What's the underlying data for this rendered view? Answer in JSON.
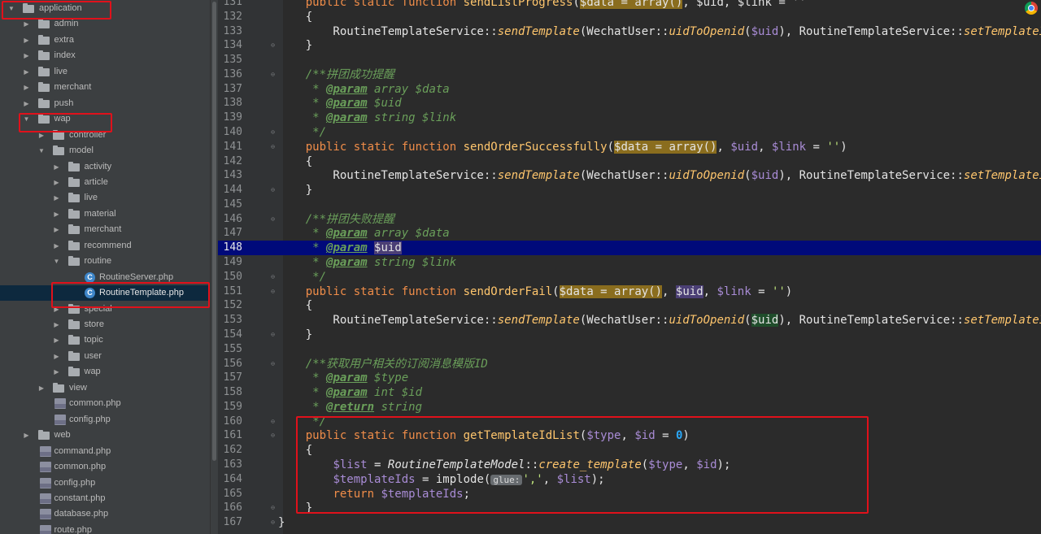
{
  "tree": [
    {
      "label": "application",
      "kind": "folder",
      "depth": 0,
      "open": true
    },
    {
      "label": "admin",
      "kind": "folder",
      "depth": 1,
      "open": false
    },
    {
      "label": "extra",
      "kind": "folder",
      "depth": 1,
      "open": false
    },
    {
      "label": "index",
      "kind": "folder",
      "depth": 1,
      "open": false
    },
    {
      "label": "live",
      "kind": "folder",
      "depth": 1,
      "open": false
    },
    {
      "label": "merchant",
      "kind": "folder",
      "depth": 1,
      "open": false
    },
    {
      "label": "push",
      "kind": "folder",
      "depth": 1,
      "open": false
    },
    {
      "label": "wap",
      "kind": "folder",
      "depth": 1,
      "open": true
    },
    {
      "label": "controller",
      "kind": "folder",
      "depth": 2,
      "open": false
    },
    {
      "label": "model",
      "kind": "folder",
      "depth": 2,
      "open": true
    },
    {
      "label": "activity",
      "kind": "folder",
      "depth": 3,
      "open": false
    },
    {
      "label": "article",
      "kind": "folder",
      "depth": 3,
      "open": false
    },
    {
      "label": "live",
      "kind": "folder",
      "depth": 3,
      "open": false
    },
    {
      "label": "material",
      "kind": "folder",
      "depth": 3,
      "open": false
    },
    {
      "label": "merchant",
      "kind": "folder",
      "depth": 3,
      "open": false
    },
    {
      "label": "recommend",
      "kind": "folder",
      "depth": 3,
      "open": false
    },
    {
      "label": "routine",
      "kind": "folder",
      "depth": 3,
      "open": true
    },
    {
      "label": "RoutineServer.php",
      "kind": "class",
      "depth": 4
    },
    {
      "label": "RoutineTemplate.php",
      "kind": "class",
      "depth": 4,
      "selected": true
    },
    {
      "label": "special",
      "kind": "folder",
      "depth": 3,
      "open": false
    },
    {
      "label": "store",
      "kind": "folder",
      "depth": 3,
      "open": false
    },
    {
      "label": "topic",
      "kind": "folder",
      "depth": 3,
      "open": false
    },
    {
      "label": "user",
      "kind": "folder",
      "depth": 3,
      "open": false
    },
    {
      "label": "wap",
      "kind": "folder",
      "depth": 3,
      "open": false
    },
    {
      "label": "view",
      "kind": "folder",
      "depth": 2,
      "open": false
    },
    {
      "label": "common.php",
      "kind": "php",
      "depth": 2
    },
    {
      "label": "config.php",
      "kind": "php",
      "depth": 2
    },
    {
      "label": "web",
      "kind": "folder",
      "depth": 1,
      "open": false
    },
    {
      "label": "command.php",
      "kind": "php",
      "depth": 1
    },
    {
      "label": "common.php",
      "kind": "php",
      "depth": 1
    },
    {
      "label": "config.php",
      "kind": "php",
      "depth": 1
    },
    {
      "label": "constant.php",
      "kind": "php",
      "depth": 1
    },
    {
      "label": "database.php",
      "kind": "php",
      "depth": 1
    },
    {
      "label": "route.php",
      "kind": "php",
      "depth": 1
    }
  ],
  "code": [
    {
      "n": "131",
      "fold": "",
      "t": [
        [
          "    ",
          ""
        ],
        [
          "public static function ",
          "t-kw"
        ],
        [
          "sendListProgress",
          "t-fn"
        ],
        [
          "(",
          ""
        ],
        [
          "$data = array()",
          "t-hl-o"
        ],
        [
          ", $uid, $link = ''",
          ""
        ]
      ]
    },
    {
      "n": "132",
      "fold": "",
      "t": [
        [
          "    {",
          ""
        ]
      ]
    },
    {
      "n": "133",
      "fold": "",
      "t": [
        [
          "        RoutineTemplateService::",
          ""
        ],
        [
          "sendTemplate",
          "t-st"
        ],
        [
          "(WechatUser::",
          ""
        ],
        [
          "uidToOpenid",
          "t-st"
        ],
        [
          "(",
          ""
        ],
        [
          "$uid",
          "t-var"
        ],
        [
          "), RoutineTemplateService::",
          ""
        ],
        [
          "setTemplateId",
          "t-st"
        ]
      ]
    },
    {
      "n": "134",
      "fold": "⊖",
      "t": [
        [
          "    }",
          ""
        ]
      ]
    },
    {
      "n": "135",
      "fold": "",
      "t": []
    },
    {
      "n": "136",
      "fold": "⊖",
      "t": [
        [
          "    /**拼团成功提醒",
          "t-cm"
        ]
      ]
    },
    {
      "n": "137",
      "fold": "",
      "t": [
        [
          "     * ",
          "t-cm"
        ],
        [
          "@param",
          "t-tag"
        ],
        [
          " array $data",
          "t-cm"
        ]
      ]
    },
    {
      "n": "138",
      "fold": "",
      "t": [
        [
          "     * ",
          "t-cm"
        ],
        [
          "@param",
          "t-tag"
        ],
        [
          " $uid",
          "t-cm"
        ]
      ]
    },
    {
      "n": "139",
      "fold": "",
      "t": [
        [
          "     * ",
          "t-cm"
        ],
        [
          "@param",
          "t-tag"
        ],
        [
          " string $link",
          "t-cm"
        ]
      ]
    },
    {
      "n": "140",
      "fold": "⊖",
      "t": [
        [
          "     */",
          "t-cm"
        ]
      ]
    },
    {
      "n": "141",
      "fold": "⊖",
      "t": [
        [
          "    ",
          ""
        ],
        [
          "public static function ",
          "t-kw"
        ],
        [
          "sendOrderSuccessfully",
          "t-fn"
        ],
        [
          "(",
          ""
        ],
        [
          "$data = array()",
          "t-hl-o"
        ],
        [
          ", ",
          ""
        ],
        [
          "$uid",
          "t-var"
        ],
        [
          ", ",
          ""
        ],
        [
          "$link",
          "t-var"
        ],
        [
          " = ",
          ""
        ],
        [
          "''",
          "t-str"
        ],
        [
          ")",
          ""
        ]
      ]
    },
    {
      "n": "142",
      "fold": "",
      "t": [
        [
          "    {",
          ""
        ]
      ]
    },
    {
      "n": "143",
      "fold": "",
      "t": [
        [
          "        RoutineTemplateService::",
          ""
        ],
        [
          "sendTemplate",
          "t-st"
        ],
        [
          "(WechatUser::",
          ""
        ],
        [
          "uidToOpenid",
          "t-st"
        ],
        [
          "(",
          ""
        ],
        [
          "$uid",
          "t-var"
        ],
        [
          "), RoutineTemplateService::",
          ""
        ],
        [
          "setTemplateId",
          "t-st"
        ]
      ]
    },
    {
      "n": "144",
      "fold": "⊖",
      "t": [
        [
          "    }",
          ""
        ]
      ]
    },
    {
      "n": "145",
      "fold": "",
      "t": []
    },
    {
      "n": "146",
      "fold": "⊖",
      "t": [
        [
          "    /**拼团失败提醒",
          "t-cm"
        ]
      ]
    },
    {
      "n": "147",
      "fold": "",
      "t": [
        [
          "     * ",
          "t-cm"
        ],
        [
          "@param",
          "t-tag"
        ],
        [
          " array $data",
          "t-cm"
        ]
      ]
    },
    {
      "n": "148",
      "fold": "",
      "cur": true,
      "t": [
        [
          "     * ",
          "t-cm"
        ],
        [
          "@param",
          "t-tag"
        ],
        [
          " ",
          "t-cm"
        ],
        [
          "$uid",
          "t-hl-p"
        ]
      ]
    },
    {
      "n": "149",
      "fold": "",
      "t": [
        [
          "     * ",
          "t-cm"
        ],
        [
          "@param",
          "t-tag"
        ],
        [
          " string $link",
          "t-cm"
        ]
      ]
    },
    {
      "n": "150",
      "fold": "⊖",
      "t": [
        [
          "     */",
          "t-cm"
        ]
      ]
    },
    {
      "n": "151",
      "fold": "⊖",
      "t": [
        [
          "    ",
          ""
        ],
        [
          "public static function ",
          "t-kw"
        ],
        [
          "sendOrderFail",
          "t-fn"
        ],
        [
          "(",
          ""
        ],
        [
          "$data = array()",
          "t-hl-o"
        ],
        [
          ", ",
          ""
        ],
        [
          "$uid",
          "t-hl-p"
        ],
        [
          ", ",
          ""
        ],
        [
          "$link",
          "t-var"
        ],
        [
          " = ",
          ""
        ],
        [
          "''",
          "t-str"
        ],
        [
          ")",
          ""
        ]
      ]
    },
    {
      "n": "152",
      "fold": "",
      "t": [
        [
          "    {",
          ""
        ]
      ]
    },
    {
      "n": "153",
      "fold": "",
      "t": [
        [
          "        RoutineTemplateService::",
          ""
        ],
        [
          "sendTemplate",
          "t-st"
        ],
        [
          "(WechatUser::",
          ""
        ],
        [
          "uidToOpenid",
          "t-st"
        ],
        [
          "(",
          ""
        ],
        [
          "$uid",
          "t-hl-g"
        ],
        [
          "), RoutineTemplateService::",
          ""
        ],
        [
          "setTemplateId",
          "t-st"
        ]
      ]
    },
    {
      "n": "154",
      "fold": "⊖",
      "t": [
        [
          "    }",
          ""
        ]
      ]
    },
    {
      "n": "155",
      "fold": "",
      "t": []
    },
    {
      "n": "156",
      "fold": "⊖",
      "t": [
        [
          "    /**获取用户相关的订阅消息模版ID",
          "t-cm"
        ]
      ]
    },
    {
      "n": "157",
      "fold": "",
      "t": [
        [
          "     * ",
          "t-cm"
        ],
        [
          "@param",
          "t-tag"
        ],
        [
          " $type",
          "t-cm"
        ]
      ]
    },
    {
      "n": "158",
      "fold": "",
      "t": [
        [
          "     * ",
          "t-cm"
        ],
        [
          "@param",
          "t-tag"
        ],
        [
          " int $id",
          "t-cm"
        ]
      ]
    },
    {
      "n": "159",
      "fold": "",
      "t": [
        [
          "     * ",
          "t-cm"
        ],
        [
          "@return",
          "t-tag"
        ],
        [
          " string",
          "t-cm"
        ]
      ]
    },
    {
      "n": "160",
      "fold": "⊖",
      "t": [
        [
          "     */",
          "t-cm"
        ]
      ]
    },
    {
      "n": "161",
      "fold": "⊖",
      "t": [
        [
          "    ",
          ""
        ],
        [
          "public static function ",
          "t-kw"
        ],
        [
          "getTemplateIdList",
          "t-fn"
        ],
        [
          "(",
          ""
        ],
        [
          "$type",
          "t-var"
        ],
        [
          ", ",
          ""
        ],
        [
          "$id",
          "t-var"
        ],
        [
          " = ",
          ""
        ],
        [
          "0",
          "t-num"
        ],
        [
          ")",
          ""
        ]
      ]
    },
    {
      "n": "162",
      "fold": "",
      "t": [
        [
          "    {",
          ""
        ]
      ]
    },
    {
      "n": "163",
      "fold": "",
      "t": [
        [
          "        ",
          ""
        ],
        [
          "$list",
          "t-var"
        ],
        [
          " = ",
          ""
        ],
        [
          "RoutineTemplateModel",
          "t-clsi"
        ],
        [
          "::",
          ""
        ],
        [
          "create_template",
          "t-st"
        ],
        [
          "(",
          ""
        ],
        [
          "$type",
          "t-var"
        ],
        [
          ", ",
          ""
        ],
        [
          "$id",
          "t-var"
        ],
        [
          ");",
          ""
        ]
      ]
    },
    {
      "n": "164",
      "fold": "",
      "t": [
        [
          "        ",
          ""
        ],
        [
          "$templateIds",
          "t-var"
        ],
        [
          " = implode(",
          ""
        ],
        [
          "glue:",
          "t-hint"
        ],
        [
          "','",
          "t-str"
        ],
        [
          ", ",
          ""
        ],
        [
          "$list",
          "t-var"
        ],
        [
          ");",
          ""
        ]
      ]
    },
    {
      "n": "165",
      "fold": "",
      "t": [
        [
          "        ",
          ""
        ],
        [
          "return ",
          "t-kw"
        ],
        [
          "$templateIds",
          "t-var"
        ],
        [
          ";",
          ""
        ]
      ]
    },
    {
      "n": "166",
      "fold": "⊖",
      "t": [
        [
          "    }",
          ""
        ]
      ]
    },
    {
      "n": "167",
      "fold": "⊖",
      "t": [
        [
          "}",
          ""
        ]
      ]
    }
  ]
}
